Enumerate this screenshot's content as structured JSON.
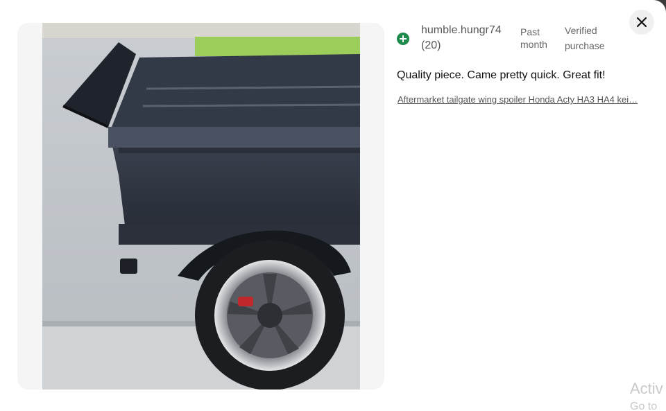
{
  "review": {
    "username": "humble.hungr74",
    "review_count": "(20)",
    "time_line1": "Past",
    "time_line2": "month",
    "verified_line1": "Verified",
    "verified_line2": "purchase",
    "text": "Quality piece. Came pretty quick. Great fit!",
    "product_link": "Aftermarket tailgate wing spoiler Honda Acty HA3 HA4 kei…"
  },
  "photo": {
    "subject": "truck-bed-with-wheel-and-spoiler"
  },
  "icons": {
    "close": "close-icon",
    "follow": "plus-circle-icon"
  },
  "colors": {
    "accent_green": "#1e8a4c",
    "link_gray": "#555555"
  },
  "watermark": {
    "line1": "Activ",
    "line2": "Go to"
  }
}
